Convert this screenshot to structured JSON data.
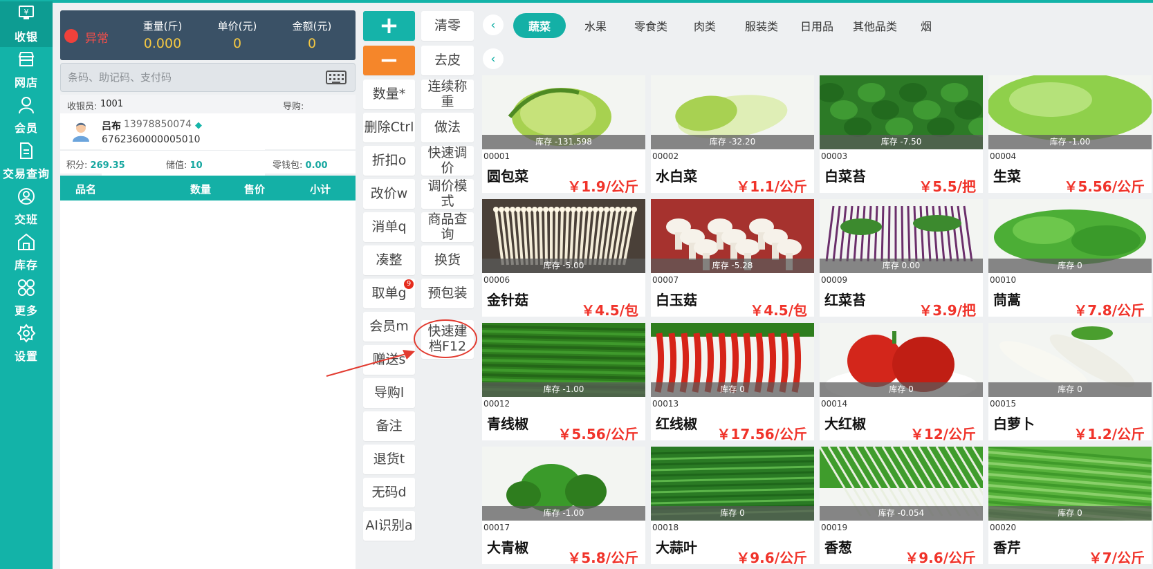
{
  "nav": [
    {
      "label": "收银",
      "icon": "cash-register-icon",
      "active": true
    },
    {
      "label": "网店",
      "icon": "store-icon"
    },
    {
      "label": "会员",
      "icon": "member-icon"
    },
    {
      "label": "交易查询",
      "icon": "document-icon"
    },
    {
      "label": "交班",
      "icon": "shift-icon"
    },
    {
      "label": "库存",
      "icon": "warehouse-icon"
    },
    {
      "label": "更多",
      "icon": "more-icon"
    },
    {
      "label": "设置",
      "icon": "gear-icon"
    }
  ],
  "scale": {
    "status": "异常",
    "weight_label": "重量(斤)",
    "weight_value": "0.000",
    "unit_price_label": "单价(元)",
    "unit_price_value": "0",
    "amount_label": "金额(元)",
    "amount_value": "0"
  },
  "search": {
    "placeholder": "条码、助记码、支付码"
  },
  "cashier": {
    "label": "收银员:",
    "value": "1001",
    "guide_label": "导购:"
  },
  "member": {
    "name": "吕布",
    "phone": "13978850074",
    "card": "6762360000005010",
    "points_label": "积分:",
    "points": "269.35",
    "stored_label": "储值:",
    "stored": "10",
    "change_label": "零钱包:",
    "change": "0.00"
  },
  "cart_headers": [
    "品名",
    "数量",
    "售价",
    "小计"
  ],
  "buttons_left": [
    {
      "label": "+",
      "type": "plus"
    },
    {
      "label": "−",
      "type": "minus"
    },
    {
      "label": "数量*"
    },
    {
      "label": "删除Ctrl"
    },
    {
      "label": "折扣o"
    },
    {
      "label": "改价w"
    },
    {
      "label": "消单q"
    },
    {
      "label": "凑整"
    },
    {
      "label": "取单g",
      "badge": "9"
    },
    {
      "label": "会员m"
    },
    {
      "label": "赠送s"
    },
    {
      "label": "导购l"
    },
    {
      "label": "备注"
    },
    {
      "label": "退货t"
    },
    {
      "label": "无码d"
    },
    {
      "label": "AI识别a"
    }
  ],
  "buttons_right": [
    {
      "label": "清零"
    },
    {
      "label": "去皮"
    },
    {
      "label": "连续称重"
    },
    {
      "label": "做法"
    },
    {
      "label": "快速调价"
    },
    {
      "label": "调价模式"
    },
    {
      "label": "商品查询"
    },
    {
      "label": "换货"
    },
    {
      "label": "预包装"
    },
    {
      "label": "快速建档F12"
    }
  ],
  "categories": [
    "蔬菜",
    "水果",
    "零食类",
    "肉类",
    "服装类",
    "日用品",
    "其他品类",
    "烟"
  ],
  "active_category": "蔬菜",
  "products": [
    {
      "code": "00001",
      "name": "圆包菜",
      "price": "￥1.9/公斤",
      "stock": "库存 -131.598",
      "kind": "cabbage",
      "color": "#8cc63f"
    },
    {
      "code": "00002",
      "name": "水白菜",
      "price": "￥1.1/公斤",
      "stock": "库存 -32.20",
      "kind": "napa",
      "color": "#b8d96a"
    },
    {
      "code": "00003",
      "name": "白菜苔",
      "price": "￥5.5/把",
      "stock": "库存 -7.50",
      "kind": "leafy",
      "color": "#2f8a2a"
    },
    {
      "code": "00004",
      "name": "生菜",
      "price": "￥5.56/公斤",
      "stock": "库存 -1.00",
      "kind": "lettuce",
      "color": "#7cc842"
    },
    {
      "code": "00006",
      "name": "金针菇",
      "price": "￥4.5/包",
      "stock": "库存 -5.00",
      "kind": "enoki",
      "color": "#f1ead6"
    },
    {
      "code": "00007",
      "name": "白玉菇",
      "price": "￥4.5/包",
      "stock": "库存 -5.28",
      "kind": "mushroom",
      "color": "#e9e3d8"
    },
    {
      "code": "00009",
      "name": "红菜苔",
      "price": "￥3.9/把",
      "stock": "库存 0.00",
      "kind": "purple",
      "color": "#6a2f6a"
    },
    {
      "code": "00010",
      "name": "茼蒿",
      "price": "￥7.8/公斤",
      "stock": "库存 0",
      "kind": "leafy2",
      "color": "#4caf38"
    },
    {
      "code": "00012",
      "name": "青线椒",
      "price": "￥5.56/公斤",
      "stock": "库存 -1.00",
      "kind": "greenchili",
      "color": "#2e7d1e"
    },
    {
      "code": "00013",
      "name": "红线椒",
      "price": "￥17.56/公斤",
      "stock": "库存 0",
      "kind": "redchili",
      "color": "#d62418"
    },
    {
      "code": "00014",
      "name": "大红椒",
      "price": "￥12/公斤",
      "stock": "库存 0",
      "kind": "redpepper",
      "color": "#d3261b"
    },
    {
      "code": "00015",
      "name": "白萝卜",
      "price": "￥1.2/公斤",
      "stock": "库存 0",
      "kind": "radish",
      "color": "#f4f4ef"
    },
    {
      "code": "00017",
      "name": "大青椒",
      "price": "￥5.8/公斤",
      "stock": "库存 -1.00",
      "kind": "greenpepper",
      "color": "#3a9a2a"
    },
    {
      "code": "00018",
      "name": "大蒜叶",
      "price": "￥9.6/公斤",
      "stock": "库存 0",
      "kind": "garlic",
      "color": "#2f8a2a"
    },
    {
      "code": "00019",
      "name": "香葱",
      "price": "￥9.6/公斤",
      "stock": "库存 -0.054",
      "kind": "scallion",
      "color": "#3f9c2c"
    },
    {
      "code": "00020",
      "name": "香芹",
      "price": "￥7/公斤",
      "stock": "库存 0",
      "kind": "celery",
      "color": "#58b23c"
    }
  ]
}
